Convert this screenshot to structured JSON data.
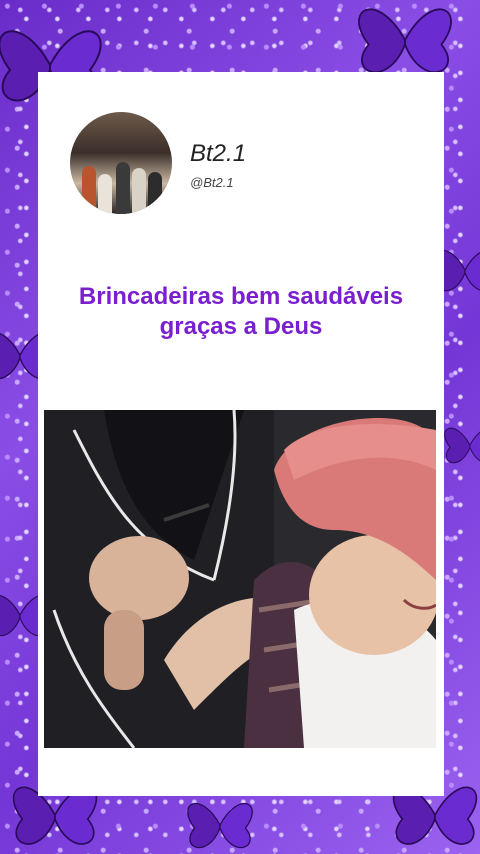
{
  "profile": {
    "name": "Bt2.1",
    "handle": "@Bt2.1"
  },
  "post": {
    "caption_line1": "Brincadeiras bem saudáveis",
    "caption_line2": "graças a Deus"
  },
  "colors": {
    "background": "#7b3fd8",
    "caption": "#7a1fd0",
    "card": "#ffffff"
  }
}
